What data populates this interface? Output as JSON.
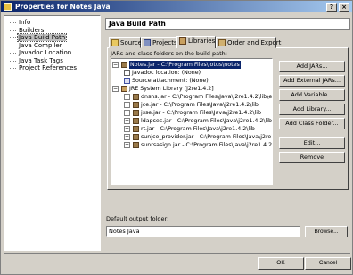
{
  "window": {
    "title": "Properties for Notes Java"
  },
  "sidebar": {
    "items": [
      {
        "label": "Info"
      },
      {
        "label": "Builders"
      },
      {
        "label": "Java Build Path"
      },
      {
        "label": "Java Compiler"
      },
      {
        "label": "Javadoc Location"
      },
      {
        "label": "Java Task Tags"
      },
      {
        "label": "Project References"
      }
    ]
  },
  "main": {
    "heading": "Java Build Path",
    "tabs": [
      {
        "label": "Source"
      },
      {
        "label": "Projects"
      },
      {
        "label": "Libraries"
      },
      {
        "label": "Order and Export"
      }
    ],
    "caption": "JARs and class folders on the build path:",
    "tree": [
      {
        "label": "Notes.jar - C:\\Program Files\\lotus\\notes"
      },
      {
        "label": "Javadoc location: (None)"
      },
      {
        "label": "Source attachment: (None)"
      },
      {
        "label": "JRE System Library [j2re1.4.2]"
      },
      {
        "label": "dnsns.jar - C:\\Program Files\\Java\\j2re1.4.2\\lib\\ext"
      },
      {
        "label": "jce.jar - C:\\Program Files\\Java\\j2re1.4.2\\lib"
      },
      {
        "label": "jsse.jar - C:\\Program Files\\Java\\j2re1.4.2\\lib"
      },
      {
        "label": "ldapsec.jar - C:\\Program Files\\Java\\j2re1.4.2\\lib\\ext"
      },
      {
        "label": "rt.jar - C:\\Program Files\\Java\\j2re1.4.2\\lib"
      },
      {
        "label": "sunjce_provider.jar - C:\\Program Files\\Java\\j2re1.4.2"
      },
      {
        "label": "sunrsasign.jar - C:\\Program Files\\Java\\j2re1.4.2\\lib"
      }
    ],
    "buttons": {
      "add_jars": "Add JARs...",
      "add_external_jars": "Add External JARs...",
      "add_variable": "Add Variable...",
      "add_library": "Add Library...",
      "add_class_folder": "Add Class Folder...",
      "edit": "Edit...",
      "remove": "Remove"
    },
    "output": {
      "label": "Default output folder:",
      "value": "Notes Java",
      "browse": "Browse..."
    }
  },
  "footer": {
    "ok": "OK",
    "cancel": "Cancel"
  },
  "colors": {
    "selection": "#0a246a",
    "title_gradient_start": "#0a246a",
    "title_gradient_end": "#a6caf0",
    "dialog_bg": "#d4d0c8"
  }
}
